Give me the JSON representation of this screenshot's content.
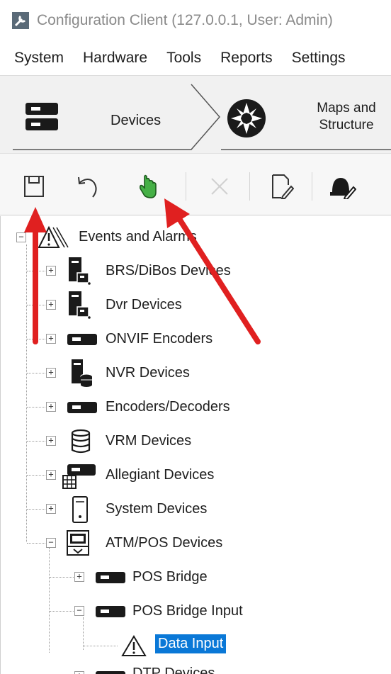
{
  "window": {
    "title": "Configuration Client (127.0.0.1, User: Admin)"
  },
  "menu": {
    "items": [
      "System",
      "Hardware",
      "Tools",
      "Reports",
      "Settings"
    ]
  },
  "ribbon": {
    "tabs": [
      {
        "label": "Devices",
        "icon": "devices-icon"
      },
      {
        "label": "Maps and\nStructure",
        "icon": "maps-structure-icon"
      }
    ]
  },
  "toolbar": {
    "buttons": [
      {
        "name": "save-icon"
      },
      {
        "name": "undo-icon"
      },
      {
        "name": "activate-hand-icon"
      },
      {
        "name": "delete-icon"
      },
      {
        "name": "edit-document-icon"
      },
      {
        "name": "alarm-edit-icon"
      }
    ]
  },
  "tree": {
    "root": {
      "label": "Events and Alarms",
      "icon": "warning-icon"
    },
    "items": [
      {
        "label": "BRS/DiBos Devices",
        "icon": "server-icon",
        "expander": "+"
      },
      {
        "label": "Dvr Devices",
        "icon": "server-icon",
        "expander": "+"
      },
      {
        "label": "ONVIF Encoders",
        "icon": "encoder-icon",
        "expander": "+"
      },
      {
        "label": "NVR Devices",
        "icon": "nvr-icon",
        "expander": "+"
      },
      {
        "label": "Encoders/Decoders",
        "icon": "encoder-icon",
        "expander": "+"
      },
      {
        "label": "VRM Devices",
        "icon": "storage-icon",
        "expander": "+"
      },
      {
        "label": "Allegiant Devices",
        "icon": "allegiant-icon",
        "expander": "+"
      },
      {
        "label": "System Devices",
        "icon": "system-device-icon",
        "expander": "+"
      },
      {
        "label": "ATM/POS Devices",
        "icon": "atm-icon",
        "expander": "−"
      }
    ],
    "children": [
      {
        "label": "POS Bridge",
        "icon": "encoder-icon",
        "expander": "+"
      },
      {
        "label": "POS Bridge Input",
        "icon": "encoder-icon",
        "expander": "−"
      }
    ],
    "selected": {
      "label": "Data Input",
      "icon": "warning-icon"
    },
    "cutoff": {
      "label": "DTP Devices",
      "icon": "encoder-icon",
      "expander": "+"
    }
  },
  "colors": {
    "selection": "#0a78d7",
    "arrow": "#e02020",
    "hand_icon": "#3aa63a"
  }
}
